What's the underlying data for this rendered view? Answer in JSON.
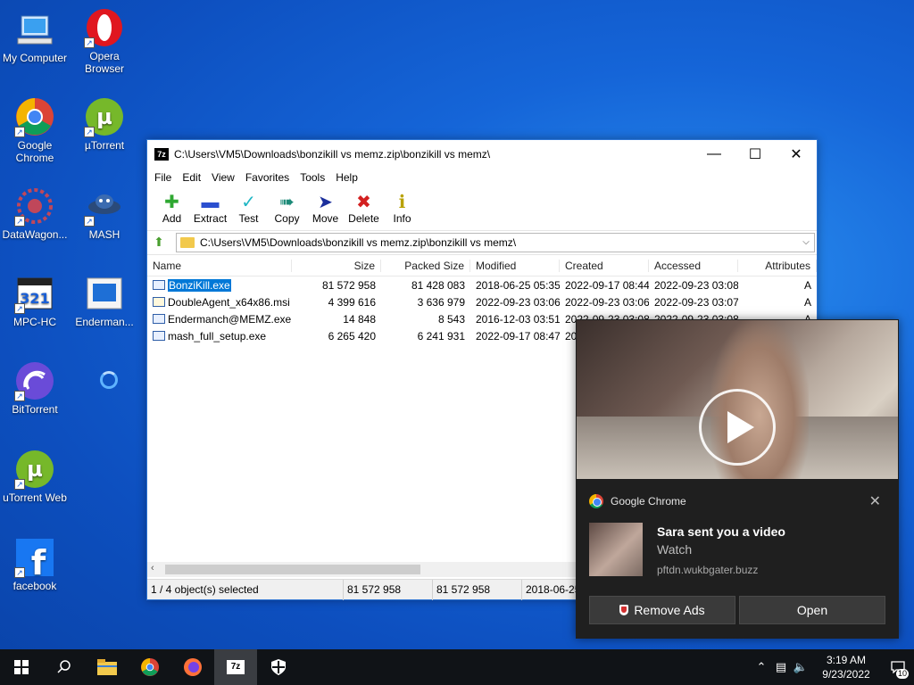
{
  "desktop": {
    "icons": [
      {
        "label": "My Computer"
      },
      {
        "label": "Opera Browser"
      },
      {
        "label": "Google Chrome"
      },
      {
        "label": "µTorrent"
      },
      {
        "label": "DataWagon..."
      },
      {
        "label": "MASH"
      },
      {
        "label": "MPC-HC"
      },
      {
        "label": "Enderman..."
      },
      {
        "label": "BitTorrent"
      },
      {
        "label": "uTorrent Web"
      },
      {
        "label": "facebook"
      }
    ]
  },
  "window": {
    "title": "C:\\Users\\VM5\\Downloads\\bonzikill vs memz.zip\\bonzikill vs memz\\",
    "app_icon": "7z",
    "menu": [
      "File",
      "Edit",
      "View",
      "Favorites",
      "Tools",
      "Help"
    ],
    "toolbar": [
      "Add",
      "Extract",
      "Test",
      "Copy",
      "Move",
      "Delete",
      "Info"
    ],
    "address": "C:\\Users\\VM5\\Downloads\\bonzikill vs memz.zip\\bonzikill vs memz\\",
    "columns": [
      "Name",
      "Size",
      "Packed Size",
      "Modified",
      "Created",
      "Accessed",
      "Attributes"
    ],
    "rows": [
      {
        "name": "BonziKill.exe",
        "size": "81 572 958",
        "packed": "81 428 083",
        "modified": "2018-06-25 05:35",
        "created": "2022-09-17 08:44",
        "accessed": "2022-09-23 03:08",
        "attr": "A"
      },
      {
        "name": "DoubleAgent_x64x86.msi",
        "size": "4 399 616",
        "packed": "3 636 979",
        "modified": "2022-09-23 03:06",
        "created": "2022-09-23 03:06",
        "accessed": "2022-09-23 03:07",
        "attr": "A"
      },
      {
        "name": "Endermanch@MEMZ.exe",
        "size": "14 848",
        "packed": "8 543",
        "modified": "2016-12-03 03:51",
        "created": "2022-09-23 03:08",
        "accessed": "2022-09-23 03:08",
        "attr": "A"
      },
      {
        "name": "mash_full_setup.exe",
        "size": "6 265 420",
        "packed": "6 241 931",
        "modified": "2022-09-17 08:47",
        "created": "20",
        "accessed": "",
        "attr": ""
      }
    ],
    "status": [
      "1 / 4 object(s) selected",
      "81 572 958",
      "81 572 958",
      "2018-06-25"
    ]
  },
  "notification": {
    "app": "Google Chrome",
    "title": "Sara sent you a video",
    "body": "Watch",
    "url": "pftdn.wukbgater.buzz",
    "btn_remove": "Remove Ads",
    "btn_open": "Open"
  },
  "taskbar": {
    "time": "3:19 AM",
    "date": "9/23/2022",
    "notif_count": "10",
    "app_7z": "7z"
  }
}
